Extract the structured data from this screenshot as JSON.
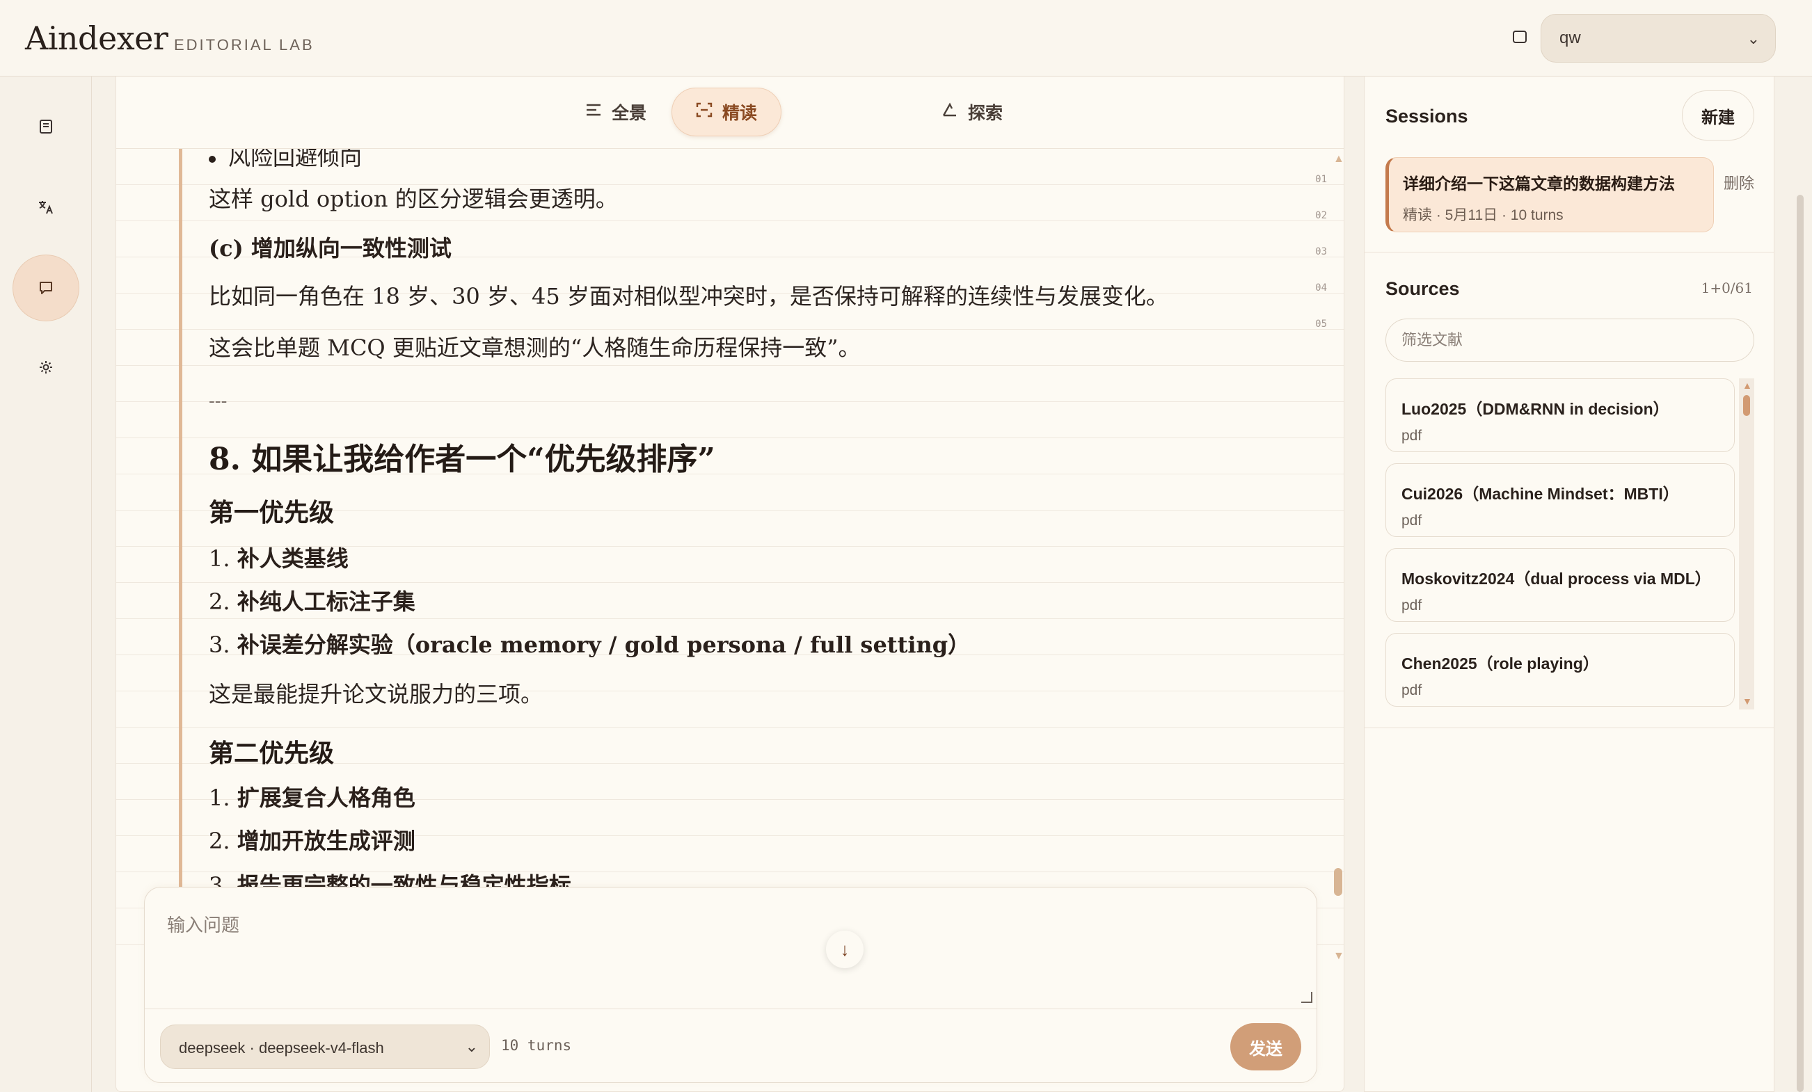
{
  "header": {
    "brand": "Aindexer",
    "brand_sub": "EDITORIAL LAB",
    "user_select": "qw"
  },
  "tabs": [
    {
      "label": "全景",
      "icon": "list-icon"
    },
    {
      "label": "精读",
      "icon": "focus-icon"
    },
    {
      "label": "探索",
      "icon": "compass-icon"
    }
  ],
  "doc": {
    "partial_bullet": "风险回避倾向",
    "p1": "这样 gold option 的区分逻辑会更透明。",
    "h3": "(c) 增加纵向一致性测试",
    "p2": "比如同一角色在 18 岁、30 岁、45 岁面对相似型冲突时，是否保持可解释的连续性与发展变化。",
    "p3": "这会比单题 MCQ 更贴近文章想测的“人格随生命历程保持一致”。",
    "rule": "---",
    "h2": "8. 如果让我给作者一个“优先级排序”",
    "sub1": "第一优先级",
    "list1": [
      "补人类基线",
      "补纯人工标注子集",
      "补误差分解实验（oracle memory / gold persona / full setting）"
    ],
    "p4": "这是最能提升论文说服力的三项。",
    "sub2": "第二优先级",
    "list2": [
      "扩展复合人格角色",
      "增加开放生成评测",
      "报告更完整的一致性与稳定性指标"
    ],
    "line_numbers": [
      "01",
      "02",
      "03",
      "04",
      "05"
    ]
  },
  "composer": {
    "placeholder": "输入问题",
    "model": "deepseek · deepseek-v4-flash",
    "turns": "10 turns",
    "send": "发送"
  },
  "sessions": {
    "title": "Sessions",
    "new_label": "新建",
    "delete_label": "删除",
    "items": [
      {
        "title": "详细介绍一下这篇文章的数据构建方法",
        "meta": "精读 · 5月11日 · 10 turns"
      }
    ]
  },
  "sources": {
    "title": "Sources",
    "count": "1+0/61",
    "filter_placeholder": "筛选文献",
    "items": [
      {
        "title": "Luo2025（DDM&RNN in decision）",
        "type": "pdf"
      },
      {
        "title": "Cui2026（Machine Mindset：MBTI）",
        "type": "pdf"
      },
      {
        "title": "Moskovitz2024（dual process via MDL）",
        "type": "pdf"
      },
      {
        "title": "Chen2025（role playing）",
        "type": "pdf"
      }
    ]
  },
  "colors": {
    "accent": "#c47a4c",
    "send_button": "#d19e78",
    "active_tab_bg": "#fbe8d7"
  }
}
